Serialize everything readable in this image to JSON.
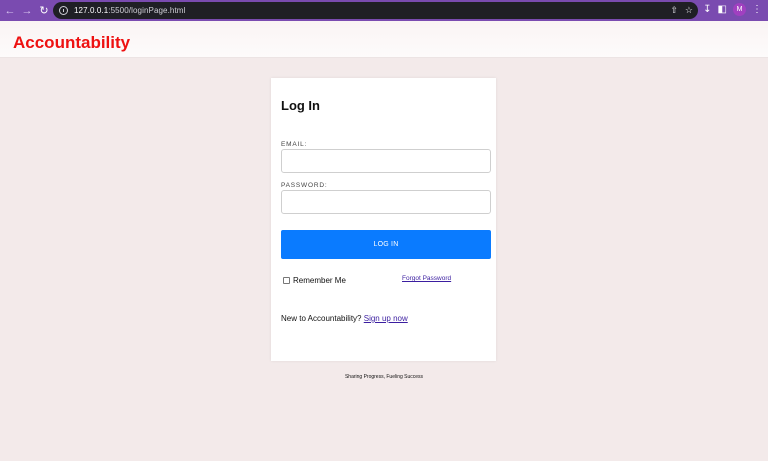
{
  "browser": {
    "url_host": "127.0.0.1",
    "url_path": ":5500/loginPage.html",
    "profile_initial": "M"
  },
  "header": {
    "brand": "Accountability",
    "brand_color": "#ee1111"
  },
  "login": {
    "title": "Log In",
    "email_label": "EMAIL:",
    "email_value": "",
    "password_label": "PASSWORD:",
    "password_value": "",
    "submit_label": "LOG IN",
    "button_color": "#0a7bff",
    "remember_label": "Remember Me",
    "forgot_link": "Forgot Password",
    "signup_prompt": "New to Accountability?",
    "signup_link": "Sign up now"
  },
  "footer": {
    "tagline": "Sharing Progress, Fueling Success"
  }
}
